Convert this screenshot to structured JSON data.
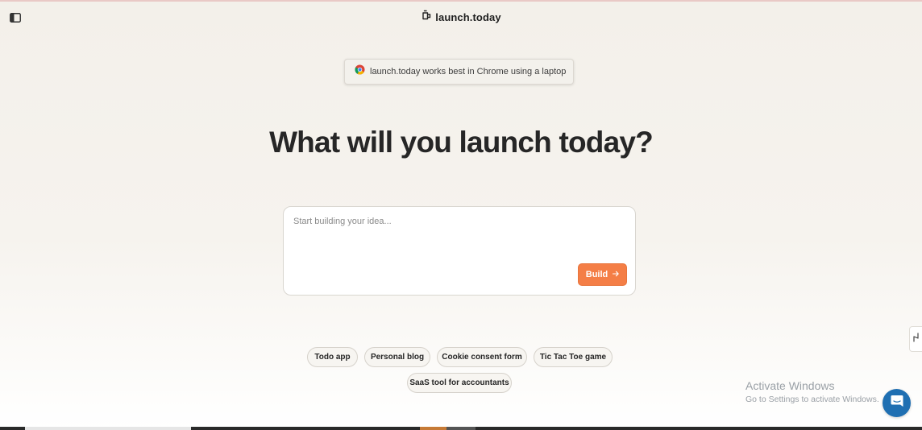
{
  "header": {
    "brand": "launch.today",
    "sidebar_icon": "sidebar-toggle-icon",
    "brand_icon": "rocket-icon"
  },
  "notice": {
    "text": "launch.today works best in Chrome using a laptop",
    "icon": "chrome-icon"
  },
  "hero": {
    "headline": "What will you launch today?"
  },
  "prompt": {
    "placeholder": "Start building your idea...",
    "value": "",
    "build_label": "Build",
    "build_icon": "arrow-right-icon"
  },
  "suggestions": [
    {
      "label": "Todo app"
    },
    {
      "label": "Personal blog"
    },
    {
      "label": "Cookie consent form"
    },
    {
      "label": "Tic Tac Toe game"
    },
    {
      "label": "SaaS tool for accountants"
    }
  ],
  "os_overlay": {
    "activate_title": "Activate Windows",
    "activate_sub": "Go to Settings to activate Windows."
  },
  "colors": {
    "accent": "#f47e46",
    "chat": "#1f6fb2"
  }
}
